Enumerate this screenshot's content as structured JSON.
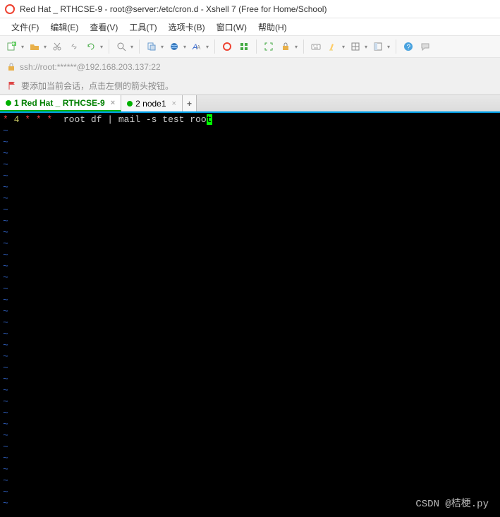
{
  "title": "Red Hat _ RTHCSE-9 - root@server:/etc/cron.d - Xshell 7 (Free for Home/School)",
  "menus": {
    "file": "文件(F)",
    "edit": "编辑(E)",
    "view": "查看(V)",
    "tools": "工具(T)",
    "tabs": "选项卡(B)",
    "window": "窗口(W)",
    "help": "帮助(H)"
  },
  "address": "ssh://root:******@192.168.203.137:22",
  "hint": "要添加当前会话，点击左侧的箭头按钮。",
  "tabs": [
    {
      "label": "1 Red Hat _ RTHCSE-9",
      "active": true,
      "color": "#00b100"
    },
    {
      "label": "2 node1",
      "active": false,
      "color": "#00b100"
    }
  ],
  "terminal": {
    "line_parts": {
      "cron1": "* ",
      "cron2": "4",
      "cron3": " * * *  ",
      "cron4": "root df | mail -s test roo",
      "cron5": "t"
    },
    "tilde_rows": 34
  },
  "watermark": "CSDN @桔梗.py"
}
